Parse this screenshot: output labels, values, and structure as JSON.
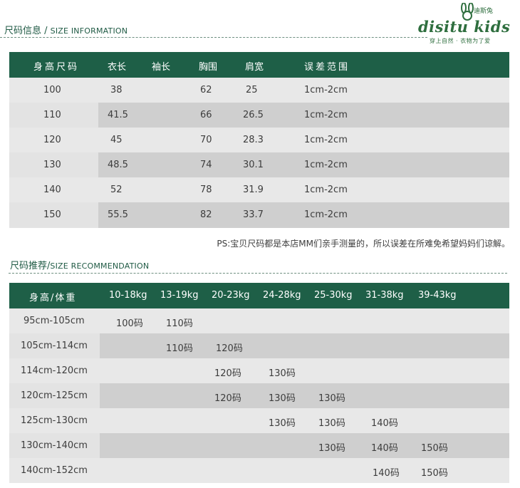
{
  "section1": {
    "title_cn": "尺码信息 / ",
    "title_en": "SIZE INFORMATION"
  },
  "logo": {
    "main": "disitu kids",
    "brand": "迪斯兔",
    "slogan": "穿上自然 · 衣物为了爱",
    "icon": "rabbit-icon",
    "color": "#2e6e3e"
  },
  "size_table": {
    "headers": [
      "身高尺码",
      "衣长",
      "袖长",
      "胸围",
      "肩宽",
      "误差范围"
    ],
    "rows": [
      [
        "100",
        "38",
        "",
        "62",
        "25",
        "1cm-2cm"
      ],
      [
        "110",
        "41.5",
        "",
        "66",
        "26.5",
        "1cm-2cm"
      ],
      [
        "120",
        "45",
        "",
        "70",
        "28.3",
        "1cm-2cm"
      ],
      [
        "130",
        "48.5",
        "",
        "74",
        "30.1",
        "1cm-2cm"
      ],
      [
        "140",
        "52",
        "",
        "78",
        "31.9",
        "1cm-2cm"
      ],
      [
        "150",
        "55.5",
        "",
        "82",
        "33.7",
        "1cm-2cm"
      ]
    ]
  },
  "note": "PS:宝贝尺码都是本店MM们亲手测量的，所以误差在所难免希望妈妈们谅解。",
  "section2": {
    "title_cn": "尺码推荐/",
    "title_en": "SIZE RECOMMENDATION"
  },
  "rec_table": {
    "headers": [
      "身高/体重",
      "10-18kg",
      "13-19kg",
      "20-23kg",
      "24-28kg",
      "25-30kg",
      "31-38kg",
      "39-43kg"
    ],
    "rows": [
      [
        "95cm-105cm",
        "100码",
        "110码",
        "",
        "",
        "",
        "",
        ""
      ],
      [
        "105cm-114cm",
        "",
        "110码",
        "120码",
        "",
        "",
        "",
        ""
      ],
      [
        "114cm-120cm",
        "",
        "",
        "120码",
        "130码",
        "",
        "",
        ""
      ],
      [
        "120cm-125cm",
        "",
        "",
        "120码",
        "130码",
        "130码",
        "",
        ""
      ],
      [
        "125cm-130cm",
        "",
        "",
        "",
        "130码",
        "130码",
        "140码",
        ""
      ],
      [
        "130cm-140cm",
        "",
        "",
        "",
        "",
        "130码",
        "140码",
        "150码"
      ],
      [
        "140cm-152cm",
        "",
        "",
        "",
        "",
        "",
        "140码",
        "150码"
      ]
    ]
  },
  "colors": {
    "header_bg": "#1e5f47",
    "row_light": "#e8e8e8",
    "row_dark": "#cfcfcf",
    "accent": "#1f5a44"
  }
}
